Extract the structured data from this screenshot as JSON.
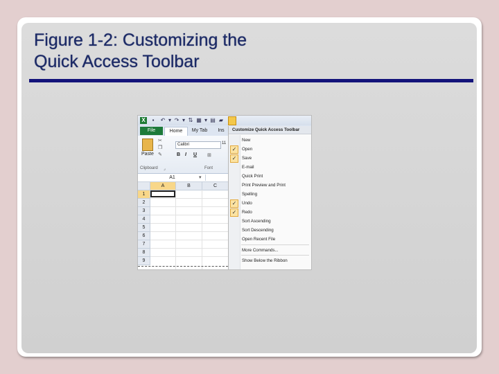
{
  "slide": {
    "title_line1": "Figure 1-2: Customizing the",
    "title_line2": "Quick Access Toolbar",
    "title_color": "#1c2a66",
    "rule_color": "#13137a"
  },
  "excel": {
    "tabs": [
      "File",
      "Home",
      "My Tab",
      "Ins"
    ],
    "ribbon": {
      "paste_label": "Paste",
      "font_name": "Calibri",
      "font_size": "11",
      "bold": "B",
      "italic": "I",
      "underline": "U",
      "clipboard_group": "Clipboard",
      "font_group": "Font"
    },
    "name_box": "A1",
    "columns": [
      "A",
      "B",
      "C"
    ],
    "rows": [
      "1",
      "2",
      "3",
      "4",
      "5",
      "6",
      "7",
      "8",
      "9"
    ]
  },
  "menu": {
    "title": "Customize Quick Access Toolbar",
    "items": [
      {
        "label": "New",
        "checked": false
      },
      {
        "label": "Open",
        "checked": true
      },
      {
        "label": "Save",
        "checked": true
      },
      {
        "label": "E-mail",
        "checked": false
      },
      {
        "label": "Quick Print",
        "checked": false
      },
      {
        "label": "Print Preview and Print",
        "checked": false
      },
      {
        "label": "Spelling",
        "checked": false
      },
      {
        "label": "Undo",
        "checked": true
      },
      {
        "label": "Redo",
        "checked": true
      },
      {
        "label": "Sort Ascending",
        "checked": false
      },
      {
        "label": "Sort Descending",
        "checked": false
      },
      {
        "label": "Open Recent File",
        "checked": false
      }
    ],
    "more_commands": "More Commands...",
    "show_below": "Show Below the Ribbon"
  }
}
